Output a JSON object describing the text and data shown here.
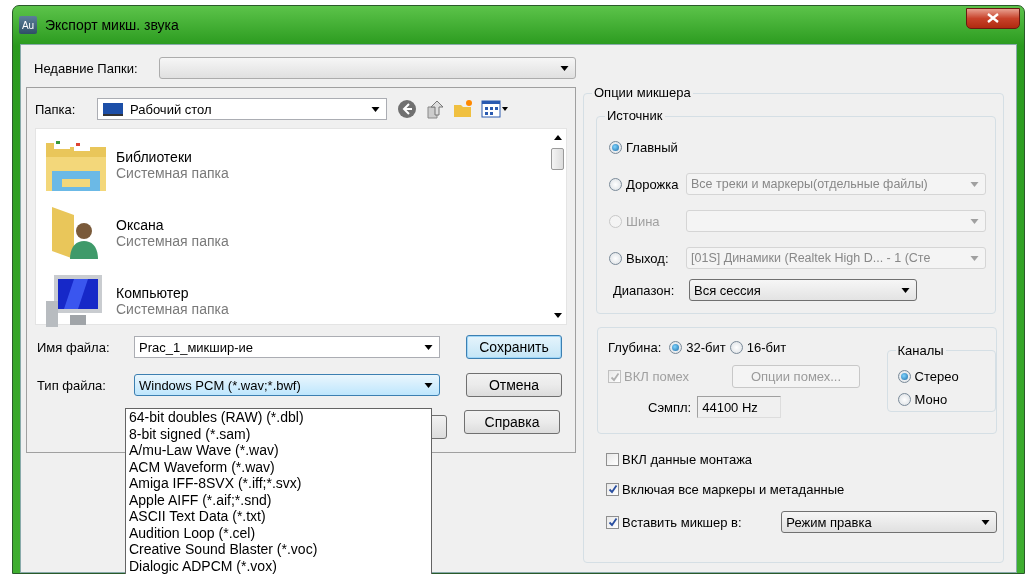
{
  "window": {
    "app_icon": "Au",
    "title": "Экспорт микш. звука"
  },
  "recent_folders": {
    "label": "Недавние Папки:"
  },
  "folder": {
    "label": "Папка:",
    "value": "Рабочий стол"
  },
  "files": [
    {
      "name": "Библиотеки",
      "type": "Системная папка",
      "kind": "library"
    },
    {
      "name": "Оксана",
      "type": "Системная папка",
      "kind": "user"
    },
    {
      "name": "Компьютер",
      "type": "Системная папка",
      "kind": "computer"
    }
  ],
  "file_name": {
    "label": "Имя файла:",
    "value": "Prac_1_микшир-ие"
  },
  "file_type": {
    "label": "Тип файла:",
    "value": "Windows PCM (*.wav;*.bwf)",
    "expanded": true,
    "options": [
      "64-bit doubles (RAW) (*.dbl)",
      "8-bit signed (*.sam)",
      "A/mu-Law Wave (*.wav)",
      "ACM Waveform (*.wav)",
      "Amiga IFF-8SVX (*.iff;*.svx)",
      "Apple AIFF (*.aif;*.snd)",
      "ASCII Text Data (*.txt)",
      "Audition Loop (*.cel)",
      "Creative Sound Blaster (*.voc)",
      "Dialogic ADPCM (*.vox)"
    ]
  },
  "buttons": [
    {
      "label": "Сохранить",
      "default": true
    },
    {
      "label": "Отмена",
      "default": false
    },
    {
      "label": "Справка",
      "default": false
    }
  ],
  "mixer_options": {
    "title": "Опции микшера",
    "source": {
      "title": "Источник",
      "options": [
        {
          "kind": "plain",
          "label": "Главный",
          "selected": true,
          "disabled": false
        },
        {
          "kind": "combo",
          "label": "Дорожка",
          "selected": false,
          "disabled": false,
          "dropdown": "Все треки и маркеры(отдельные файлы)"
        },
        {
          "kind": "combo",
          "label": "Шина",
          "selected": false,
          "disabled": true
        },
        {
          "kind": "combo",
          "label": "Выход:",
          "selected": false,
          "disabled": false,
          "dropdown": "[01S] Динамики (Realtek High D... - 1 (Сте"
        }
      ],
      "range": {
        "label": "Диапазон:",
        "value": "Вся сессия"
      }
    },
    "depth": {
      "label": "Глубина:",
      "options": [
        {
          "label": "32-бит",
          "selected": true
        },
        {
          "label": "16-бит",
          "selected": false
        }
      ]
    },
    "dither": {
      "label": "ВКЛ помех",
      "checked": true,
      "disabled": true
    },
    "dither_options": {
      "label": "Опции помех...",
      "disabled": true
    },
    "sample_rate": {
      "label": "Сэмпл:",
      "value": "44100 Hz"
    },
    "channels": {
      "title": "Каналы",
      "options": [
        {
          "label": "Стерео",
          "selected": true
        },
        {
          "label": "Моно",
          "selected": false
        }
      ]
    },
    "checkboxes": [
      {
        "label": "ВКЛ данные монтажа",
        "checked": false
      },
      {
        "label": "Включая все маркеры и метаданные",
        "checked": true
      }
    ],
    "insert_mixer": {
      "label": "Вставить микшер в:",
      "checked": true,
      "value": "Режим правка"
    }
  }
}
